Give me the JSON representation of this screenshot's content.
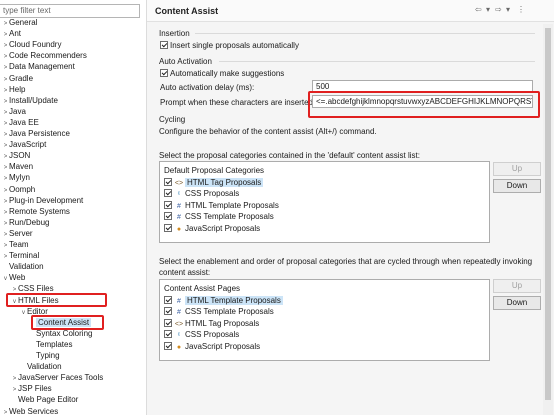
{
  "filter": {
    "placeholder": "type filter text"
  },
  "tree": [
    {
      "label": "General",
      "twisty": ">"
    },
    {
      "label": "Ant",
      "twisty": ">"
    },
    {
      "label": "Cloud Foundry",
      "twisty": ">"
    },
    {
      "label": "Code Recommenders",
      "twisty": ">"
    },
    {
      "label": "Data Management",
      "twisty": ">"
    },
    {
      "label": "Gradle",
      "twisty": ">"
    },
    {
      "label": "Help",
      "twisty": ">"
    },
    {
      "label": "Install/Update",
      "twisty": ">"
    },
    {
      "label": "Java",
      "twisty": ">"
    },
    {
      "label": "Java EE",
      "twisty": ">"
    },
    {
      "label": "Java Persistence",
      "twisty": ">"
    },
    {
      "label": "JavaScript",
      "twisty": ">"
    },
    {
      "label": "JSON",
      "twisty": ">"
    },
    {
      "label": "Maven",
      "twisty": ">"
    },
    {
      "label": "Mylyn",
      "twisty": ">"
    },
    {
      "label": "Oomph",
      "twisty": ">"
    },
    {
      "label": "Plug-in Development",
      "twisty": ">"
    },
    {
      "label": "Remote Systems",
      "twisty": ">"
    },
    {
      "label": "Run/Debug",
      "twisty": ">"
    },
    {
      "label": "Server",
      "twisty": ">"
    },
    {
      "label": "Team",
      "twisty": ">"
    },
    {
      "label": "Terminal",
      "twisty": ">"
    },
    {
      "label": "Validation",
      "twisty": ""
    },
    {
      "label": "Web",
      "twisty": "v"
    },
    {
      "label": "CSS Files",
      "twisty": ">"
    },
    {
      "label": "HTML Files",
      "twisty": "v"
    },
    {
      "label": "Editor",
      "twisty": "v"
    },
    {
      "label": "Content Assist",
      "twisty": ""
    },
    {
      "label": "Syntax Coloring",
      "twisty": ""
    },
    {
      "label": "Templates",
      "twisty": ""
    },
    {
      "label": "Typing",
      "twisty": ""
    },
    {
      "label": "Validation",
      "twisty": ""
    },
    {
      "label": "JavaServer Faces Tools",
      "twisty": ">"
    },
    {
      "label": "JSP Files",
      "twisty": ">"
    },
    {
      "label": "Web Page Editor",
      "twisty": ""
    },
    {
      "label": "Web Services",
      "twisty": ">"
    }
  ],
  "panel": {
    "title": "Content Assist",
    "nav": {
      "back": "⇦",
      "back_menu": "▾",
      "forward": "⇨",
      "forward_menu": "▾",
      "menu": "⋮"
    },
    "insertion": {
      "heading": "Insertion",
      "single_proposals": "Insert single proposals automatically"
    },
    "auto_activation": {
      "heading": "Auto Activation",
      "enable": "Automatically make suggestions",
      "delay_label": "Auto activation delay (ms):",
      "delay_value": "500",
      "triggers_label": "Prompt when these characters are inserted:",
      "triggers_value": "<=.abcdefghijklmnopqrstuvwxyzABCDEFGHIJKLMNOPQRSTUVW"
    },
    "cycling": {
      "heading": "Cycling",
      "description": "Configure the behavior of the content assist (Alt+/) command."
    },
    "default_list": {
      "label": "Select the proposal categories contained in the 'default' content assist list:",
      "header": "Default Proposal Categories",
      "items": [
        {
          "label": "HTML Tag Proposals",
          "icon": "<>"
        },
        {
          "label": "CSS Proposals",
          "icon": "ᶜ"
        },
        {
          "label": "HTML Template Proposals",
          "icon": "#"
        },
        {
          "label": "CSS Template Proposals",
          "icon": "#"
        },
        {
          "label": "JavaScript Proposals",
          "icon": "●"
        }
      ],
      "up": "Up",
      "down": "Down"
    },
    "cycle_list": {
      "label_line1": "Select the enablement and order of proposal categories that are cycled through when repeatedly invoking",
      "label_line2": "content assist:",
      "header": "Content Assist Pages",
      "items": [
        {
          "label": "HTML Template Proposals",
          "icon": "#"
        },
        {
          "label": "CSS Template Proposals",
          "icon": "#"
        },
        {
          "label": "HTML Tag Proposals",
          "icon": "<>"
        },
        {
          "label": "CSS Proposals",
          "icon": "ᶜ"
        },
        {
          "label": "JavaScript Proposals",
          "icon": "●"
        }
      ],
      "up": "Up",
      "down": "Down"
    }
  },
  "colors": {
    "highlight": "#e02020",
    "selection": "#cce4f7",
    "tag_icon": "#7a5a2a",
    "template_icon": "#3a5fa0",
    "css_icon": "#2a7ab0",
    "js_icon": "#d08a20"
  }
}
